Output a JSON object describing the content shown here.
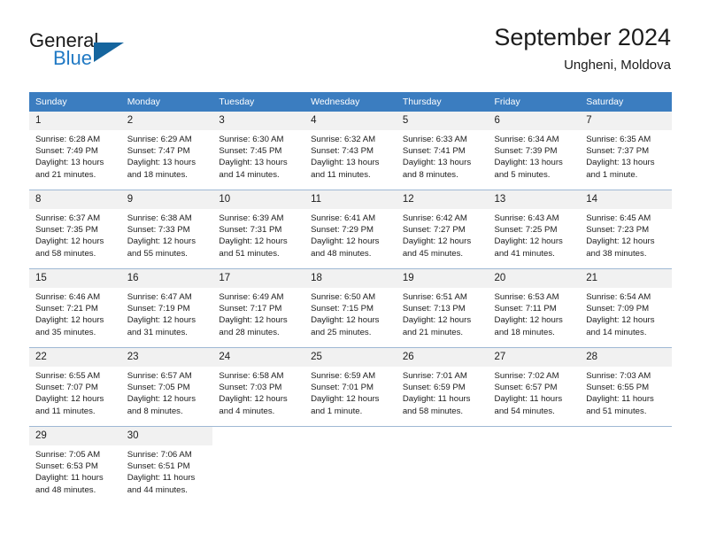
{
  "brand": {
    "line1": "General",
    "line2": "Blue",
    "triangle_color": "#15659e",
    "accent_color": "#2079c4"
  },
  "header": {
    "title": "September 2024",
    "subtitle": "Ungheni, Moldova"
  },
  "theme": {
    "header_bg": "#3b7dc0",
    "daynum_bg": "#f1f1f1",
    "grid_line": "#9fb8d4",
    "text": "#1c1c1c"
  },
  "weekday_headers": [
    "Sunday",
    "Monday",
    "Tuesday",
    "Wednesday",
    "Thursday",
    "Friday",
    "Saturday"
  ],
  "weeks": [
    {
      "days": [
        {
          "num": "1",
          "sunrise": "Sunrise: 6:28 AM",
          "sunset": "Sunset: 7:49 PM",
          "daylight1": "Daylight: 13 hours",
          "daylight2": "and 21 minutes."
        },
        {
          "num": "2",
          "sunrise": "Sunrise: 6:29 AM",
          "sunset": "Sunset: 7:47 PM",
          "daylight1": "Daylight: 13 hours",
          "daylight2": "and 18 minutes."
        },
        {
          "num": "3",
          "sunrise": "Sunrise: 6:30 AM",
          "sunset": "Sunset: 7:45 PM",
          "daylight1": "Daylight: 13 hours",
          "daylight2": "and 14 minutes."
        },
        {
          "num": "4",
          "sunrise": "Sunrise: 6:32 AM",
          "sunset": "Sunset: 7:43 PM",
          "daylight1": "Daylight: 13 hours",
          "daylight2": "and 11 minutes."
        },
        {
          "num": "5",
          "sunrise": "Sunrise: 6:33 AM",
          "sunset": "Sunset: 7:41 PM",
          "daylight1": "Daylight: 13 hours",
          "daylight2": "and 8 minutes."
        },
        {
          "num": "6",
          "sunrise": "Sunrise: 6:34 AM",
          "sunset": "Sunset: 7:39 PM",
          "daylight1": "Daylight: 13 hours",
          "daylight2": "and 5 minutes."
        },
        {
          "num": "7",
          "sunrise": "Sunrise: 6:35 AM",
          "sunset": "Sunset: 7:37 PM",
          "daylight1": "Daylight: 13 hours",
          "daylight2": "and 1 minute."
        }
      ]
    },
    {
      "days": [
        {
          "num": "8",
          "sunrise": "Sunrise: 6:37 AM",
          "sunset": "Sunset: 7:35 PM",
          "daylight1": "Daylight: 12 hours",
          "daylight2": "and 58 minutes."
        },
        {
          "num": "9",
          "sunrise": "Sunrise: 6:38 AM",
          "sunset": "Sunset: 7:33 PM",
          "daylight1": "Daylight: 12 hours",
          "daylight2": "and 55 minutes."
        },
        {
          "num": "10",
          "sunrise": "Sunrise: 6:39 AM",
          "sunset": "Sunset: 7:31 PM",
          "daylight1": "Daylight: 12 hours",
          "daylight2": "and 51 minutes."
        },
        {
          "num": "11",
          "sunrise": "Sunrise: 6:41 AM",
          "sunset": "Sunset: 7:29 PM",
          "daylight1": "Daylight: 12 hours",
          "daylight2": "and 48 minutes."
        },
        {
          "num": "12",
          "sunrise": "Sunrise: 6:42 AM",
          "sunset": "Sunset: 7:27 PM",
          "daylight1": "Daylight: 12 hours",
          "daylight2": "and 45 minutes."
        },
        {
          "num": "13",
          "sunrise": "Sunrise: 6:43 AM",
          "sunset": "Sunset: 7:25 PM",
          "daylight1": "Daylight: 12 hours",
          "daylight2": "and 41 minutes."
        },
        {
          "num": "14",
          "sunrise": "Sunrise: 6:45 AM",
          "sunset": "Sunset: 7:23 PM",
          "daylight1": "Daylight: 12 hours",
          "daylight2": "and 38 minutes."
        }
      ]
    },
    {
      "days": [
        {
          "num": "15",
          "sunrise": "Sunrise: 6:46 AM",
          "sunset": "Sunset: 7:21 PM",
          "daylight1": "Daylight: 12 hours",
          "daylight2": "and 35 minutes."
        },
        {
          "num": "16",
          "sunrise": "Sunrise: 6:47 AM",
          "sunset": "Sunset: 7:19 PM",
          "daylight1": "Daylight: 12 hours",
          "daylight2": "and 31 minutes."
        },
        {
          "num": "17",
          "sunrise": "Sunrise: 6:49 AM",
          "sunset": "Sunset: 7:17 PM",
          "daylight1": "Daylight: 12 hours",
          "daylight2": "and 28 minutes."
        },
        {
          "num": "18",
          "sunrise": "Sunrise: 6:50 AM",
          "sunset": "Sunset: 7:15 PM",
          "daylight1": "Daylight: 12 hours",
          "daylight2": "and 25 minutes."
        },
        {
          "num": "19",
          "sunrise": "Sunrise: 6:51 AM",
          "sunset": "Sunset: 7:13 PM",
          "daylight1": "Daylight: 12 hours",
          "daylight2": "and 21 minutes."
        },
        {
          "num": "20",
          "sunrise": "Sunrise: 6:53 AM",
          "sunset": "Sunset: 7:11 PM",
          "daylight1": "Daylight: 12 hours",
          "daylight2": "and 18 minutes."
        },
        {
          "num": "21",
          "sunrise": "Sunrise: 6:54 AM",
          "sunset": "Sunset: 7:09 PM",
          "daylight1": "Daylight: 12 hours",
          "daylight2": "and 14 minutes."
        }
      ]
    },
    {
      "days": [
        {
          "num": "22",
          "sunrise": "Sunrise: 6:55 AM",
          "sunset": "Sunset: 7:07 PM",
          "daylight1": "Daylight: 12 hours",
          "daylight2": "and 11 minutes."
        },
        {
          "num": "23",
          "sunrise": "Sunrise: 6:57 AM",
          "sunset": "Sunset: 7:05 PM",
          "daylight1": "Daylight: 12 hours",
          "daylight2": "and 8 minutes."
        },
        {
          "num": "24",
          "sunrise": "Sunrise: 6:58 AM",
          "sunset": "Sunset: 7:03 PM",
          "daylight1": "Daylight: 12 hours",
          "daylight2": "and 4 minutes."
        },
        {
          "num": "25",
          "sunrise": "Sunrise: 6:59 AM",
          "sunset": "Sunset: 7:01 PM",
          "daylight1": "Daylight: 12 hours",
          "daylight2": "and 1 minute."
        },
        {
          "num": "26",
          "sunrise": "Sunrise: 7:01 AM",
          "sunset": "Sunset: 6:59 PM",
          "daylight1": "Daylight: 11 hours",
          "daylight2": "and 58 minutes."
        },
        {
          "num": "27",
          "sunrise": "Sunrise: 7:02 AM",
          "sunset": "Sunset: 6:57 PM",
          "daylight1": "Daylight: 11 hours",
          "daylight2": "and 54 minutes."
        },
        {
          "num": "28",
          "sunrise": "Sunrise: 7:03 AM",
          "sunset": "Sunset: 6:55 PM",
          "daylight1": "Daylight: 11 hours",
          "daylight2": "and 51 minutes."
        }
      ]
    },
    {
      "days": [
        {
          "num": "29",
          "sunrise": "Sunrise: 7:05 AM",
          "sunset": "Sunset: 6:53 PM",
          "daylight1": "Daylight: 11 hours",
          "daylight2": "and 48 minutes."
        },
        {
          "num": "30",
          "sunrise": "Sunrise: 7:06 AM",
          "sunset": "Sunset: 6:51 PM",
          "daylight1": "Daylight: 11 hours",
          "daylight2": "and 44 minutes."
        },
        {
          "num": "",
          "sunrise": "",
          "sunset": "",
          "daylight1": "",
          "daylight2": ""
        },
        {
          "num": "",
          "sunrise": "",
          "sunset": "",
          "daylight1": "",
          "daylight2": ""
        },
        {
          "num": "",
          "sunrise": "",
          "sunset": "",
          "daylight1": "",
          "daylight2": ""
        },
        {
          "num": "",
          "sunrise": "",
          "sunset": "",
          "daylight1": "",
          "daylight2": ""
        },
        {
          "num": "",
          "sunrise": "",
          "sunset": "",
          "daylight1": "",
          "daylight2": ""
        }
      ]
    }
  ]
}
